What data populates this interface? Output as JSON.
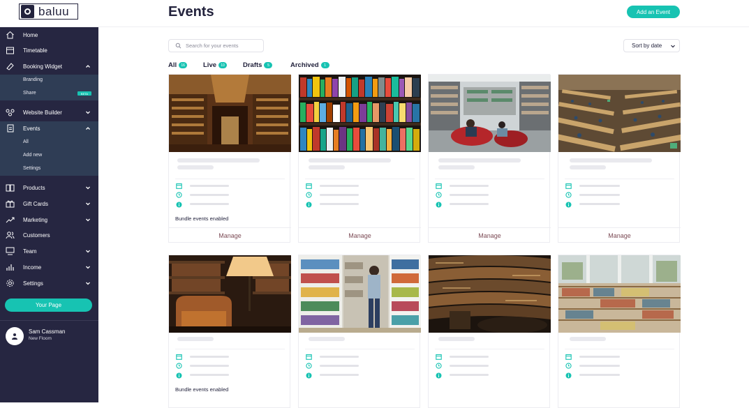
{
  "brand": {
    "logo_text": "baluu"
  },
  "header": {
    "title": "Events",
    "add_button": "Add an Event"
  },
  "sidebar": {
    "items": [
      {
        "label": "Home",
        "icon": "home-icon"
      },
      {
        "label": "Timetable",
        "icon": "calendar-icon"
      },
      {
        "label": "Booking Widget",
        "icon": "paint-icon"
      },
      {
        "label": "Website Builder",
        "icon": "sitemap-icon"
      },
      {
        "label": "Events",
        "icon": "document-icon"
      },
      {
        "label": "Products",
        "icon": "book-icon"
      },
      {
        "label": "Gift Cards",
        "icon": "gift-icon"
      },
      {
        "label": "Marketing",
        "icon": "trend-icon"
      },
      {
        "label": "Customers",
        "icon": "users-icon"
      },
      {
        "label": "Team",
        "icon": "team-icon"
      },
      {
        "label": "Income",
        "icon": "bars-icon"
      },
      {
        "label": "Settings",
        "icon": "gear-icon"
      }
    ],
    "booking_sub": [
      "Branding",
      "Share"
    ],
    "beta_badge": "BETA",
    "events_sub": [
      "All",
      "Add new",
      "Settings"
    ],
    "your_page": "Your Page",
    "user": {
      "name": "Sam Cassman",
      "subtitle": "New Floom"
    }
  },
  "search": {
    "placeholder": "Search for your events"
  },
  "sort": {
    "label": "Sort by date"
  },
  "tabs": [
    {
      "label": "All",
      "count": "16"
    },
    {
      "label": "Live",
      "count": "10"
    },
    {
      "label": "Drafts",
      "count": "5"
    },
    {
      "label": "Archived",
      "count": "1"
    }
  ],
  "cards": [
    {
      "image": "grand-library-hall",
      "bundle": "Bundle events enabled",
      "action": "Manage"
    },
    {
      "image": "colorful-bookshelf",
      "bundle": "",
      "action": "Manage"
    },
    {
      "image": "library-reading-area",
      "bundle": "",
      "action": "Manage"
    },
    {
      "image": "study-hall-tables",
      "bundle": "",
      "action": "Manage"
    },
    {
      "image": "armchair-lamp-books",
      "bundle": "Bundle events enabled",
      "action": "Manage"
    },
    {
      "image": "person-in-library-aisle",
      "bundle": "",
      "action": "Manage"
    },
    {
      "image": "curved-library-balconies",
      "bundle": "",
      "action": "Manage"
    },
    {
      "image": "bright-book-shelves",
      "bundle": "",
      "action": "Manage"
    }
  ],
  "colors": {
    "accent": "#17c3b2",
    "sidebar": "#262641",
    "manage_text": "#7d4c56"
  }
}
